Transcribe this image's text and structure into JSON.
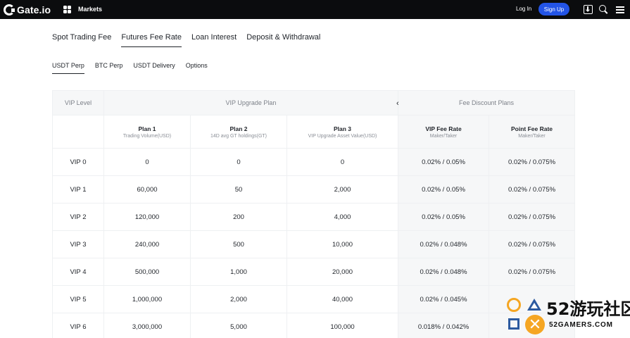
{
  "header": {
    "logo_text": "Gate.io",
    "markets_label": "Markets",
    "login_label": "Log In",
    "signup_label": "Sign Up",
    "icons": [
      "apps-icon",
      "download-icon",
      "search-icon",
      "menu-icon"
    ]
  },
  "tabs": [
    {
      "label": "Spot Trading Fee",
      "active": false
    },
    {
      "label": "Futures Fee Rate",
      "active": true
    },
    {
      "label": "Loan Interest",
      "active": false
    },
    {
      "label": "Deposit & Withdrawal",
      "active": false
    }
  ],
  "subtabs": [
    {
      "label": "USDT Perp",
      "active": true
    },
    {
      "label": "BTC Perp",
      "active": false
    },
    {
      "label": "USDT Delivery",
      "active": false
    },
    {
      "label": "Options",
      "active": false
    }
  ],
  "table": {
    "group_headers": {
      "vip_level": "VIP Level",
      "upgrade_plan": "VIP Upgrade Plan",
      "discount_plans": "Fee Discount Plans"
    },
    "columns": [
      {
        "title": "Plan 1",
        "sub": "Trading Volume(USD)"
      },
      {
        "title": "Plan 2",
        "sub": "14D avg GT holdings(GT)"
      },
      {
        "title": "Plan 3",
        "sub": "VIP Upgrade Asset Value(USD)"
      },
      {
        "title": "VIP Fee Rate",
        "sub": "Maker/Taker"
      },
      {
        "title": "Point Fee Rate",
        "sub": "Maker/Taker"
      }
    ],
    "rows": [
      {
        "level": "VIP 0",
        "plan1": "0",
        "plan2": "0",
        "plan3": "0",
        "vip_fee": "0.02% / 0.05%",
        "point_fee": "0.02% / 0.075%"
      },
      {
        "level": "VIP 1",
        "plan1": "60,000",
        "plan2": "50",
        "plan3": "2,000",
        "vip_fee": "0.02% / 0.05%",
        "point_fee": "0.02% / 0.075%"
      },
      {
        "level": "VIP 2",
        "plan1": "120,000",
        "plan2": "200",
        "plan3": "4,000",
        "vip_fee": "0.02% / 0.05%",
        "point_fee": "0.02% / 0.075%"
      },
      {
        "level": "VIP 3",
        "plan1": "240,000",
        "plan2": "500",
        "plan3": "10,000",
        "vip_fee": "0.02% / 0.048%",
        "point_fee": "0.02% / 0.075%"
      },
      {
        "level": "VIP 4",
        "plan1": "500,000",
        "plan2": "1,000",
        "plan3": "20,000",
        "vip_fee": "0.02% / 0.048%",
        "point_fee": "0.02% / 0.075%"
      },
      {
        "level": "VIP 5",
        "plan1": "1,000,000",
        "plan2": "2,000",
        "plan3": "40,000",
        "vip_fee": "0.02% / 0.045%",
        "point_fee": ""
      },
      {
        "level": "VIP 6",
        "plan1": "3,000,000",
        "plan2": "5,000",
        "plan3": "100,000",
        "vip_fee": "0.018% / 0.042%",
        "point_fee": ""
      }
    ]
  },
  "watermark": {
    "cn_text": "52游玩社区",
    "en_text": "52GAMERS.COM",
    "x_glyph": "✕"
  }
}
